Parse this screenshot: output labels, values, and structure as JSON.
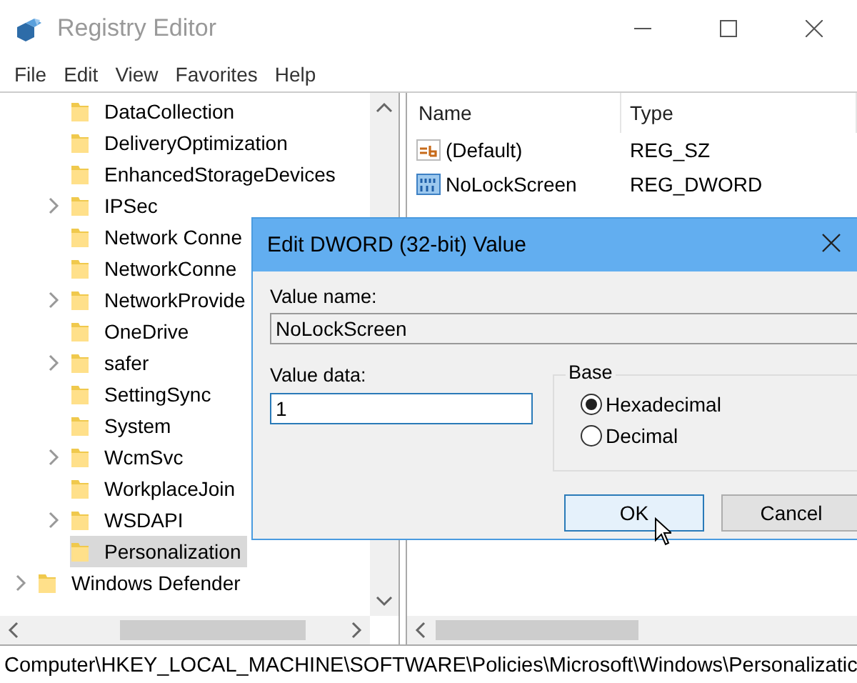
{
  "window": {
    "title": "Registry Editor"
  },
  "menu": [
    "File",
    "Edit",
    "View",
    "Favorites",
    "Help"
  ],
  "tree": {
    "items": [
      {
        "children": [
          {
            "label": "DataCollection",
            "expandable": false,
            "selected": false
          },
          {
            "label": "DeliveryOptimization",
            "expandable": false,
            "selected": false
          },
          {
            "label": "EnhancedStorageDevices",
            "expandable": false,
            "selected": false
          },
          {
            "label": "IPSec",
            "expandable": true,
            "selected": false
          },
          {
            "label": "Network Conne",
            "expandable": false,
            "selected": false
          },
          {
            "label": "NetworkConne",
            "expandable": false,
            "selected": false
          },
          {
            "label": "NetworkProvide",
            "expandable": true,
            "selected": false
          },
          {
            "label": "OneDrive",
            "expandable": false,
            "selected": false
          },
          {
            "label": "safer",
            "expandable": true,
            "selected": false
          },
          {
            "label": "SettingSync",
            "expandable": false,
            "selected": false
          },
          {
            "label": "System",
            "expandable": false,
            "selected": false
          },
          {
            "label": "WcmSvc",
            "expandable": true,
            "selected": false
          },
          {
            "label": "WorkplaceJoin",
            "expandable": false,
            "selected": false
          },
          {
            "label": "WSDAPI",
            "expandable": true,
            "selected": false
          },
          {
            "label": "Personalization",
            "expandable": false,
            "selected": true
          }
        ]
      },
      {
        "label": "Windows Defender",
        "expandable": true,
        "selected": false
      }
    ]
  },
  "values": {
    "columns": [
      "Name",
      "Type"
    ],
    "rows": [
      {
        "kind": "string",
        "name": "(Default)",
        "type": "REG_SZ"
      },
      {
        "kind": "dword",
        "name": "NoLockScreen",
        "type": "REG_DWORD"
      }
    ]
  },
  "dialog": {
    "title": "Edit DWORD (32-bit) Value",
    "value_name_label": "Value name:",
    "value_name": "NoLockScreen",
    "value_data_label": "Value data:",
    "value_data": "1",
    "base_label": "Base",
    "base_options": [
      {
        "label": "Hexadecimal",
        "selected": true
      },
      {
        "label": "Decimal",
        "selected": false
      }
    ],
    "buttons": [
      {
        "label": "OK",
        "default": true
      },
      {
        "label": "Cancel",
        "default": false
      }
    ]
  },
  "status_bar": "Computer\\HKEY_LOCAL_MACHINE\\SOFTWARE\\Policies\\Microsoft\\Windows\\Personalizatic"
}
